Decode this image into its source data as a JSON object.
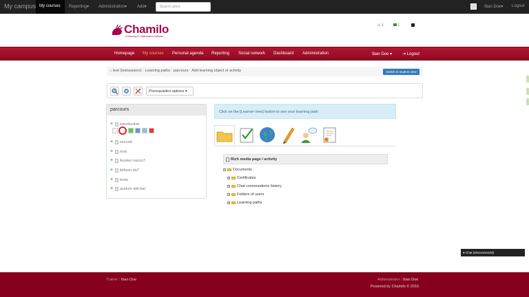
{
  "topbar": {
    "brand": "My campus",
    "items": [
      "My courses",
      "Reporting",
      "Administration",
      "Add"
    ],
    "search_placeholder": "Search users",
    "user": "Iban Doe",
    "logout": "Logout"
  },
  "header": {
    "logo_word": "Chamilo",
    "logo_tagline": "E-learning & Collaboration software",
    "stats": [
      "1",
      "1"
    ]
  },
  "mainnav": {
    "items": [
      "Homepage",
      "My courses",
      "Personal agenda",
      "Reporting",
      "Social network",
      "Dashboard",
      "Administration"
    ],
    "user": "Iban Doe",
    "logout": "Logout"
  },
  "breadcrumb": {
    "items": [
      "test (testsession)",
      "Learning paths",
      "parcours",
      "Add learning object or activity"
    ],
    "student_view_button": "Switch to student view"
  },
  "toolbar": {
    "prerequisites": "Prerequisites options"
  },
  "lp_panel": {
    "title": "parcours",
    "items": [
      "introduction",
      "second",
      "trois",
      "ikusten nauzu?",
      "ibiltzen da?",
      "testa",
      "azeken aldi bat"
    ]
  },
  "info": {
    "message": "Click on the [Learner view] button to see your learning path"
  },
  "rich_media": {
    "label": "Rich media page / activity"
  },
  "documents": {
    "root": "Documents",
    "children": [
      "Certificates",
      "Chat conversations history",
      "Folders of users",
      "Learning paths"
    ]
  },
  "chat": {
    "label": "Chat (Disconnected)"
  },
  "footer": {
    "trainer_label": "Trainer",
    "trainer": "Iban Doe",
    "admin_label": "Administrator",
    "admin": "Iban Doe",
    "powered": "Powered by Chamilo © 2016"
  }
}
